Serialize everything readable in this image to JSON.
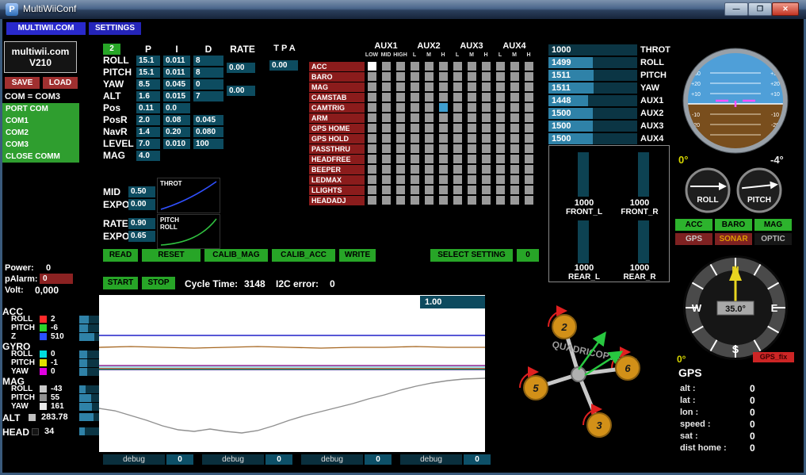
{
  "window": {
    "title": "MultiWiiConf",
    "icon_letter": "P",
    "minimize": "—",
    "maximize": "❐",
    "close": "✕"
  },
  "menu": {
    "multiwii_tab": "MULTIWII.COM",
    "settings_tab": "SETTINGS"
  },
  "left": {
    "brand_line1": "multiwii.com",
    "brand_line2": "V210",
    "save": "SAVE",
    "load": "LOAD",
    "com_status": "COM = COM3",
    "ports": [
      "PORT COM",
      "COM1",
      "COM2",
      "COM3",
      "CLOSE COMM"
    ],
    "power_label": "Power:",
    "power_value": "0",
    "palarm_label": "pAlarm:",
    "palarm_value": "0",
    "volt_label": "Volt:",
    "volt_value": "0,000",
    "groups": [
      {
        "title": "ACC",
        "rows": [
          {
            "label": "ROLL",
            "value": "2",
            "color": "#ff2a2a"
          },
          {
            "label": "PITCH",
            "value": "-6",
            "color": "#2bd42b"
          },
          {
            "label": "Z",
            "value": "510",
            "color": "#2a50ff"
          }
        ]
      },
      {
        "title": "GYRO",
        "rows": [
          {
            "label": "ROLL",
            "value": "0",
            "color": "#00dcdc"
          },
          {
            "label": "PITCH",
            "value": "-1",
            "color": "#e0e000"
          },
          {
            "label": "YAW",
            "value": "0",
            "color": "#e000e0"
          }
        ]
      },
      {
        "title": "MAG",
        "rows": [
          {
            "label": "ROLL",
            "value": "-43",
            "color": "#c8c8c8"
          },
          {
            "label": "PITCH",
            "value": "55",
            "color": "#909090"
          },
          {
            "label": "YAW",
            "value": "161",
            "color": "#e8e8e8"
          }
        ]
      }
    ],
    "alt_label": "ALT",
    "alt_value": "283.78",
    "alt_color": "#bfbfbf",
    "head_label": "HEAD",
    "head_value": "34",
    "head_color": "#141414"
  },
  "pid": {
    "setting_index": "2",
    "col_p": "P",
    "col_i": "I",
    "col_d": "D",
    "col_rate": "RATE",
    "col_tpa": "T P A",
    "rows": [
      {
        "label": "ROLL",
        "p": "15.1",
        "i": "0.011",
        "d": "8"
      },
      {
        "label": "PITCH",
        "p": "15.1",
        "i": "0.011",
        "d": "8"
      },
      {
        "label": "YAW",
        "p": "8.5",
        "i": "0.045",
        "d": "0"
      },
      {
        "label": "ALT",
        "p": "1.6",
        "i": "0.015",
        "d": "7"
      },
      {
        "label": "Pos",
        "p": "0.11",
        "i": "0.0",
        "d": ""
      },
      {
        "label": "PosR",
        "p": "2.0",
        "i": "0.08",
        "d": "0.045"
      },
      {
        "label": "NavR",
        "p": "1.4",
        "i": "0.20",
        "d": "0.080"
      },
      {
        "label": "LEVEL",
        "p": "7.0",
        "i": "0.010",
        "d": "100"
      },
      {
        "label": "MAG",
        "p": "4.0",
        "i": "",
        "d": ""
      }
    ],
    "rate_rollpitch": "0.00",
    "rate_yaw": "0.00",
    "tpa": "0.00",
    "mid_label": "MID",
    "mid": "0.50",
    "mid_expo_label": "EXPO",
    "mid_expo": "0.00",
    "throt_graph_label": "THROT",
    "rate_label": "RATE",
    "rate": "0.90",
    "rate_expo_label": "EXPO",
    "rate_expo": "0.65",
    "rc_graph_label1": "PITCH",
    "rc_graph_label2": "ROLL"
  },
  "aux": {
    "columns": [
      "AUX1",
      "AUX2",
      "AUX3",
      "AUX4"
    ],
    "sub_first": [
      "LOW",
      "MID",
      "HIGH"
    ],
    "sub": [
      "L",
      "M",
      "H"
    ],
    "items": [
      "ACC",
      "BARO",
      "MAG",
      "CAMSTAB",
      "CAMTRIG",
      "ARM",
      "GPS HOME",
      "GPS HOLD",
      "PASSTHRU",
      "HEADFREE",
      "BEEPER",
      "LEDMAX",
      "LLIGHTS",
      "HEADADJ"
    ],
    "cell_color": "#9a9a9a",
    "special_cells": [
      {
        "row": 0,
        "col": 0,
        "color": "#ffffff"
      },
      {
        "row": 4,
        "col": 5,
        "color": "#3f9fd0"
      }
    ]
  },
  "actions": {
    "read": "READ",
    "reset": "RESET",
    "calib_mag": "CALIB_MAG",
    "calib_acc": "CALIB_ACC",
    "write": "WRITE",
    "select_setting": "SELECT SETTING",
    "setting_value": "0"
  },
  "runtime": {
    "start": "START",
    "stop": "STOP",
    "cycle_label": "Cycle Time:",
    "cycle_value": "3148",
    "i2c_label": "I2C error:",
    "i2c_value": "0",
    "scale_value": "1.00",
    "debug_label": "debug",
    "debug_values": [
      "0",
      "0",
      "0",
      "0"
    ]
  },
  "rc": {
    "channels": [
      {
        "value": 1000,
        "label": "THROT"
      },
      {
        "value": 1499,
        "label": "ROLL"
      },
      {
        "value": 1511,
        "label": "PITCH"
      },
      {
        "value": 1511,
        "label": "YAW"
      },
      {
        "value": 1448,
        "label": "AUX1"
      },
      {
        "value": 1500,
        "label": "AUX2"
      },
      {
        "value": 1500,
        "label": "AUX3"
      },
      {
        "value": 1500,
        "label": "AUX4"
      }
    ]
  },
  "motors": {
    "front_l": {
      "value": "1000",
      "label": "FRONT_L"
    },
    "front_r": {
      "value": "1000",
      "label": "FRONT_R"
    },
    "rear_l": {
      "value": "1000",
      "label": "REAR_L"
    },
    "rear_r": {
      "value": "1000",
      "label": "REAR_R"
    }
  },
  "attitude": {
    "scale": [
      "+30",
      "+20",
      "+10",
      "-10",
      "-20",
      "-30"
    ],
    "angle_left": "0°",
    "angle_right": "-4°",
    "roll_label": "ROLL",
    "pitch_label": "PITCH"
  },
  "status": [
    {
      "label": "ACC",
      "bg": "#2db32d",
      "fg": "#000000"
    },
    {
      "label": "BARO",
      "bg": "#2db32d",
      "fg": "#000000"
    },
    {
      "label": "MAG",
      "bg": "#2db32d",
      "fg": "#000000"
    },
    {
      "label": "GPS",
      "bg": "#7e2121",
      "fg": "#c8c8c8"
    },
    {
      "label": "SONAR",
      "bg": "#7e2121",
      "fg": "#e09a00"
    },
    {
      "label": "OPTIC",
      "bg": "#161616",
      "fg": "#b4b4b4"
    }
  ],
  "compass": {
    "north": "N",
    "east": "E",
    "south": "S",
    "west": "W",
    "heading": "35.0°",
    "angle": "0°",
    "gps_fix": "GPS_fix"
  },
  "gps": {
    "title": "GPS",
    "rows": [
      {
        "label": "alt :",
        "value": "0"
      },
      {
        "label": "lat :",
        "value": "0"
      },
      {
        "label": "lon :",
        "value": "0"
      },
      {
        "label": "speed :",
        "value": "0"
      },
      {
        "label": "sat :",
        "value": "0"
      },
      {
        "label": "dist home :",
        "value": "0"
      }
    ]
  },
  "quad": {
    "title": "QUADRICOPTER X",
    "motor_numbers": [
      "2",
      "6",
      "5",
      "3"
    ]
  }
}
